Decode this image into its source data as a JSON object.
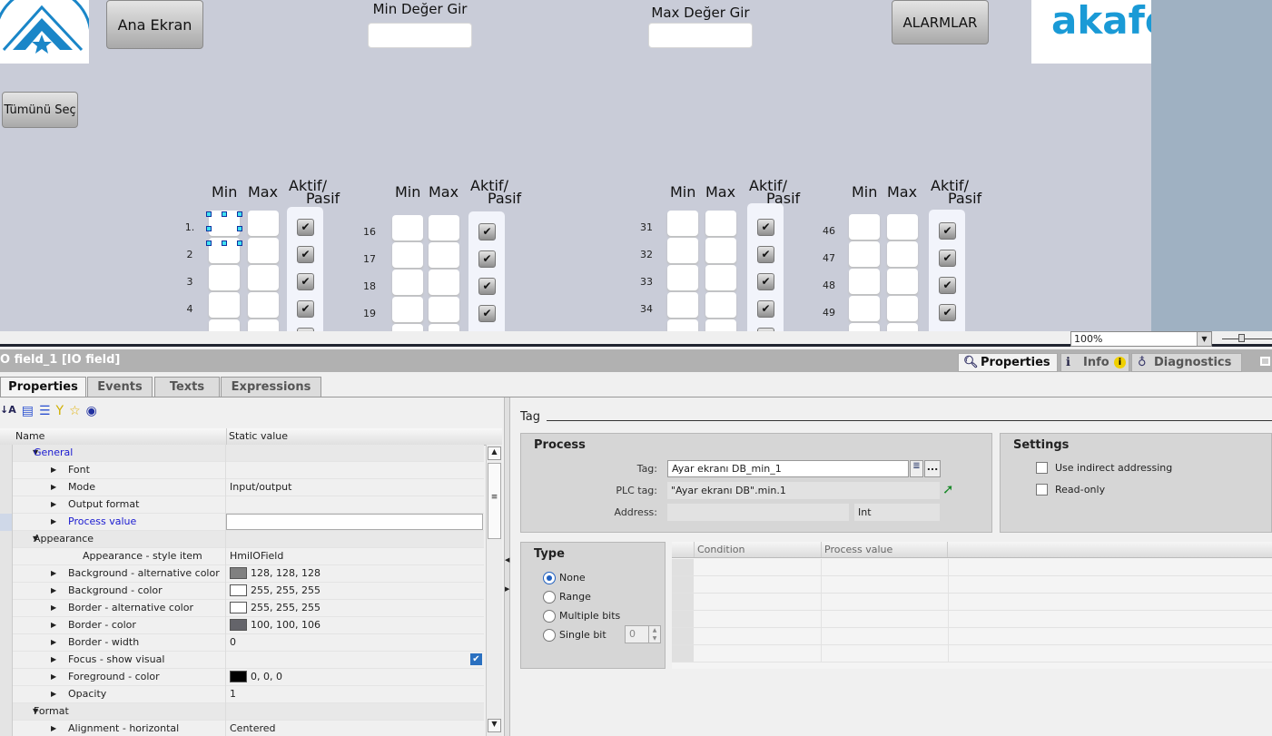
{
  "hmi": {
    "ana_ekran": "Ana Ekran",
    "min_deger_gir": "Min Değer Gir",
    "max_deger_gir": "Max Değer Gir",
    "alarmlar": "ALARMLAR",
    "tumunu_sec": "Tümünü Seç",
    "brand_logo": "akafor",
    "col_min": "Min",
    "col_max": "Max",
    "col_aktif1": "Aktif/",
    "col_aktif2": "Pasif",
    "groups": [
      [
        "1.",
        "2",
        "3",
        "4"
      ],
      [
        "16",
        "17",
        "18",
        "19"
      ],
      [
        "31",
        "32",
        "33",
        "34"
      ],
      [
        "46",
        "47",
        "48",
        "49"
      ]
    ],
    "check_mark": "✔"
  },
  "zoom": {
    "value": "100%"
  },
  "title": "O field_1 [IO field]",
  "tabs": [
    "Properties",
    "Events",
    "Texts",
    "Expressions"
  ],
  "right_tabs": [
    "Properties",
    "Info",
    "Diagnostics"
  ],
  "table": {
    "col_name": "Name",
    "col_value": "Static value",
    "rows": [
      {
        "n": "General",
        "v": "",
        "lvl": 0,
        "exp": "▼",
        "blue": true
      },
      {
        "n": "Font",
        "v": "",
        "lvl": 1,
        "exp": "▶"
      },
      {
        "n": "Mode",
        "v": "Input/output",
        "lvl": 1,
        "exp": "▶"
      },
      {
        "n": "Output format",
        "v": "",
        "lvl": 1,
        "exp": "▶"
      },
      {
        "n": "Process value",
        "v": "",
        "lvl": 1,
        "exp": "▶",
        "blue": true,
        "input": true
      },
      {
        "n": "Appearance",
        "v": "",
        "lvl": 0,
        "exp": "▼"
      },
      {
        "n": "Appearance - style item",
        "v": "HmiIOField",
        "lvl": 2,
        "exp": ""
      },
      {
        "n": "Background - alternative color",
        "v": "128, 128, 128",
        "lvl": 1,
        "exp": "▶",
        "sw": "#808080"
      },
      {
        "n": "Background - color",
        "v": "255, 255, 255",
        "lvl": 1,
        "exp": "▶",
        "sw": "#ffffff"
      },
      {
        "n": "Border - alternative color",
        "v": "255, 255, 255",
        "lvl": 1,
        "exp": "▶",
        "sw": "#ffffff"
      },
      {
        "n": "Border - color",
        "v": "100, 100, 106",
        "lvl": 1,
        "exp": "▶",
        "sw": "#64646a"
      },
      {
        "n": "Border - width",
        "v": "0",
        "lvl": 1,
        "exp": "▶"
      },
      {
        "n": "Focus - show visual",
        "v": "",
        "lvl": 1,
        "exp": "▶",
        "check": true
      },
      {
        "n": "Foreground - color",
        "v": "0, 0, 0",
        "lvl": 1,
        "exp": "▶",
        "sw": "#000000"
      },
      {
        "n": "Opacity",
        "v": "1",
        "lvl": 1,
        "exp": "▶"
      },
      {
        "n": "Format",
        "v": "",
        "lvl": 0,
        "exp": "▼"
      },
      {
        "n": "Alignment - horizontal",
        "v": "Centered",
        "lvl": 1,
        "exp": "▶"
      }
    ]
  },
  "tag_section": "Tag",
  "process": {
    "title": "Process",
    "tag_label": "Tag:",
    "tag_value": "Ayar ekranı DB_min_1",
    "plc_label": "PLC tag:",
    "plc_value": "\"Ayar ekranı DB\".min.1",
    "addr_label": "Address:",
    "addr_value": "",
    "type_value": "Int",
    "more": "..."
  },
  "settings": {
    "title": "Settings",
    "indirect": "Use indirect addressing",
    "readonly": "Read-only"
  },
  "type": {
    "title": "Type",
    "options": [
      "None",
      "Range",
      "Multiple bits",
      "Single bit"
    ],
    "selected": "None",
    "bit_value": "0"
  },
  "cond_table": {
    "col_condition": "Condition",
    "col_process": "Process value"
  }
}
